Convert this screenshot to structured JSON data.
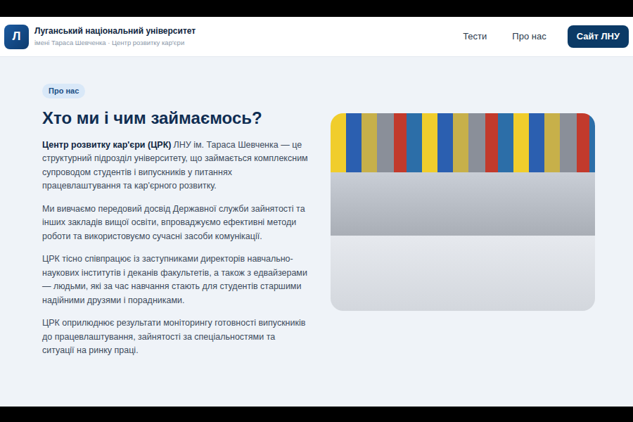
{
  "header": {
    "logo": "Л",
    "title": "Луганський національний університет",
    "subtitle": "імені Тараса Шевченка · Центр розвитку кар'єри"
  },
  "nav": [
    {
      "label": "Тести"
    },
    {
      "label": "Про нас"
    }
  ],
  "cta": "Сайт ЛНУ",
  "section": {
    "badge": "Про нас",
    "heading": "Хто ми і чим займаємось?",
    "intro": {
      "strong": "Центр розвитку кар'єри (ЦРК)",
      "text": "ЛНУ ім. Тараса Шевченка — це структурний підрозділ університету, що займається комплексним супроводом студентів і випускників у питаннях працевлаштування та кар'єрного розвитку."
    },
    "paragraphs": [
      "Ми вивчаємо передовий досвід Державної служби зайнятості та інших закладів вищої освіти, впроваджуємо ефективні методи роботи та використовуємо сучасні засоби комунікації.",
      "ЦРК тісно співпрацює із заступниками директорів навчально-наукових інститутів і деканів факультетів, а також з едвайзерами — людьми, які за час навчання стають для студентів старшими надійними друзями і порадниками.",
      "ЦРК оприлюднює результати моніторингу готовності випускників до працевлаштування, зайнятості за спеціальностями та ситуації на ринку праці."
    ]
  }
}
